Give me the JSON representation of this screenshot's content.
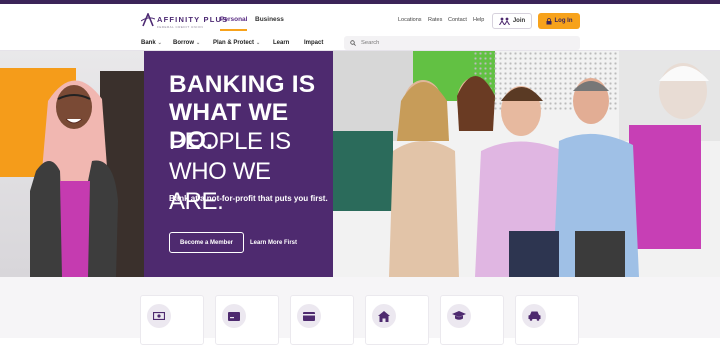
{
  "brand": {
    "name": "AFFINITY PLUS",
    "tagline": "FEDERAL CREDIT UNION",
    "colors": {
      "purple": "#4e2a6f",
      "orange": "#f7a21b",
      "magenta": "#c53bb0",
      "green": "#62c143"
    }
  },
  "header": {
    "segments": [
      {
        "label": "Personal",
        "active": true
      },
      {
        "label": "Business",
        "active": false
      }
    ],
    "utility_links": [
      "Locations",
      "Rates",
      "Contact",
      "Help"
    ],
    "join_label": "Join",
    "login_label": "Log In"
  },
  "nav": {
    "items": [
      {
        "label": "Bank",
        "has_dropdown": true
      },
      {
        "label": "Borrow",
        "has_dropdown": true
      },
      {
        "label": "Plan & Protect",
        "has_dropdown": true
      },
      {
        "label": "Learn",
        "has_dropdown": false
      },
      {
        "label": "Impact",
        "has_dropdown": false
      }
    ],
    "search_placeholder": "Search"
  },
  "hero": {
    "headline_bold": "BANKING IS WHAT WE DO.",
    "headline_light": "PEOPLE IS WHO WE ARE.",
    "subhead": "Bank at a not-for-profit that puts you first.",
    "primary_button": "Become a Member",
    "secondary_button": "Learn More First"
  },
  "quick_links": {
    "icons": [
      "cash-icon",
      "debit-card-icon",
      "credit-card-icon",
      "home-icon",
      "graduation-cap-icon",
      "car-icon"
    ]
  }
}
